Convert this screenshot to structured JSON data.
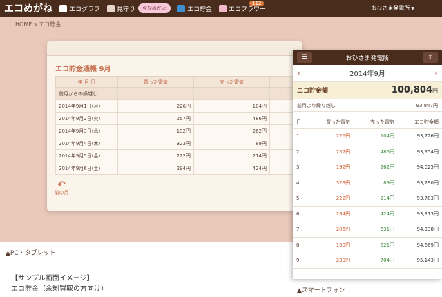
{
  "topbar": {
    "logo": "エコめがね",
    "nav": [
      {
        "label": "エコグラフ",
        "icon": "graph-icon"
      },
      {
        "label": "見守り",
        "icon": "watch-icon",
        "pill": "今なめだよ"
      },
      {
        "label": "エコ貯金",
        "icon": "piggy-bank-icon"
      },
      {
        "label": "エコフラワー",
        "icon": "flower-icon",
        "badge": "112"
      }
    ],
    "user": "おひさま発電所"
  },
  "breadcrumb": "HOME » エコ貯金",
  "desktop": {
    "title": "エコ貯金通帳 9月",
    "headers": [
      "年 月 日",
      "買った電気",
      "売った電気"
    ],
    "carry_label": "前月からの繰越し",
    "rows": [
      {
        "date": "2014年9月1日(月)",
        "bought": "226円",
        "sold": "104円"
      },
      {
        "date": "2014年9月2日(火)",
        "bought": "257円",
        "sold": "486円"
      },
      {
        "date": "2014年9月3日(水)",
        "bought": "192円",
        "sold": "262円"
      },
      {
        "date": "2014年9月4日(木)",
        "bought": "323円",
        "sold": "89円"
      },
      {
        "date": "2014年9月5日(金)",
        "bought": "222円",
        "sold": "214円"
      },
      {
        "date": "2014年9月6日(土)",
        "bought": "294円",
        "sold": "424円"
      }
    ],
    "prev_month": "前の月"
  },
  "caption_pc": "▲PC・タブレット",
  "sample_line1": "【サンプル画面イメージ】",
  "sample_line2": "エコ貯金（余剰買取の方向け）",
  "caption_sp": "▲スマートフォン",
  "phone": {
    "title": "おひさま発電所",
    "month": "2014年9月",
    "total_label": "エコ貯金額",
    "total_value": "100,804",
    "total_unit": "円",
    "carry_label": "前月より繰り越し",
    "carry_value": "93,847円",
    "headers": [
      "日",
      "買った電気",
      "売った電気",
      "エコ貯金額"
    ],
    "rows": [
      {
        "day": "1",
        "bought": "226円",
        "sold": "104円",
        "balance": "93,726円"
      },
      {
        "day": "2",
        "bought": "257円",
        "sold": "486円",
        "balance": "93,954円"
      },
      {
        "day": "3",
        "bought": "192円",
        "sold": "262円",
        "balance": "94,025円"
      },
      {
        "day": "4",
        "bought": "323円",
        "sold": "89円",
        "balance": "93,790円"
      },
      {
        "day": "5",
        "bought": "222円",
        "sold": "214円",
        "balance": "93,783円"
      },
      {
        "day": "6",
        "bought": "294円",
        "sold": "424円",
        "balance": "93,913円"
      },
      {
        "day": "7",
        "bought": "206円",
        "sold": "631円",
        "balance": "94,338円"
      },
      {
        "day": "8",
        "bought": "190円",
        "sold": "521円",
        "balance": "94,669円"
      },
      {
        "day": "9",
        "bought": "230円",
        "sold": "704円",
        "balance": "95,143円"
      }
    ]
  }
}
